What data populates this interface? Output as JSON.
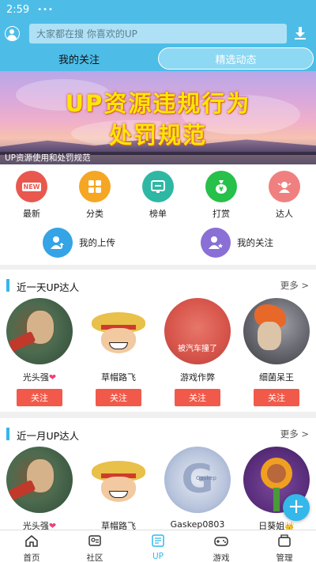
{
  "status": {
    "time": "2:59",
    "dots": "•••"
  },
  "header": {
    "search_placeholder": "大家都在搜 你喜欢的UP",
    "tabs": [
      {
        "label": "我的关注"
      },
      {
        "label": "精选动态"
      }
    ]
  },
  "banner": {
    "title_line1": "UP资源违规行为",
    "title_line2": "处罚规范",
    "caption": "UP资源使用和处罚规范"
  },
  "quick": {
    "items": [
      {
        "label": "最新",
        "badge": "NEW",
        "color": "#e8584e",
        "icon": "new-icon"
      },
      {
        "label": "分类",
        "color": "#f5a623",
        "icon": "grid-icon"
      },
      {
        "label": "榜单",
        "color": "#2eb8a4",
        "icon": "chart-board-icon"
      },
      {
        "label": "打赏",
        "color": "#27c04a",
        "icon": "money-bag-icon"
      },
      {
        "label": "达人",
        "color": "#f08080",
        "icon": "expert-icon"
      }
    ],
    "uploads": {
      "label": "我的上传",
      "color": "#34a4e6",
      "icon": "upload-user-icon"
    },
    "follows": {
      "label": "我的关注",
      "color": "#8a6fd6",
      "icon": "follow-user-icon"
    }
  },
  "section_day": {
    "title": "近一天UP达人",
    "more": "更多 >",
    "users": [
      {
        "name": "光头强",
        "heart": "❤",
        "follow": "关注"
      },
      {
        "name": "草帽路飞",
        "follow": "关注"
      },
      {
        "name": "游戏作弊",
        "overlay": "被汽车撞了",
        "follow": "关注"
      },
      {
        "name": "细菌呆王",
        "follow": "关注"
      }
    ]
  },
  "section_month": {
    "title": "近一月UP达人",
    "more": "更多 >",
    "users": [
      {
        "name": "光头强",
        "heart": "❤"
      },
      {
        "name": "草帽路飞"
      },
      {
        "name": "Gaskep0803",
        "logo_letter": "G",
        "logo_text": "Gaskep"
      },
      {
        "name": "日葵姐",
        "badge": "👑"
      }
    ]
  },
  "fab": {
    "symbol": "+"
  },
  "nav": {
    "items": [
      {
        "label": "首页",
        "icon": "home-icon"
      },
      {
        "label": "社区",
        "icon": "community-icon"
      },
      {
        "label": "UP",
        "icon": "up-icon"
      },
      {
        "label": "游戏",
        "icon": "gamepad-icon"
      },
      {
        "label": "管理",
        "icon": "manage-icon"
      }
    ],
    "active": "UP",
    "accent": "#34b7ea"
  }
}
